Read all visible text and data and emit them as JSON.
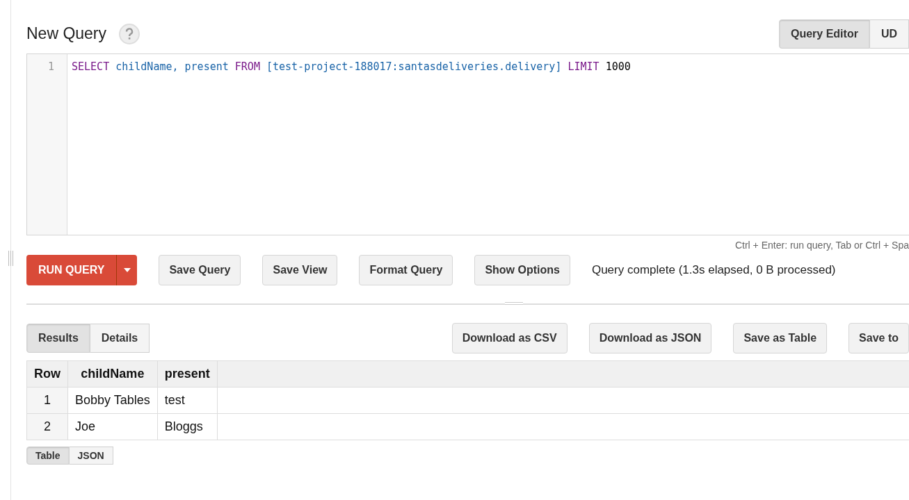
{
  "title": "New Query",
  "view_tabs": [
    {
      "label": "Query Editor",
      "selected": true
    },
    {
      "label": "UD",
      "selected": false
    }
  ],
  "editor": {
    "lines": [
      {
        "number": "1",
        "tokens": [
          {
            "kind": "keyword",
            "text": "SELECT"
          },
          {
            "kind": "ident",
            "text": "childName,"
          },
          {
            "kind": "ident",
            "text": "present"
          },
          {
            "kind": "keyword",
            "text": "FROM"
          },
          {
            "kind": "ident",
            "text": "[test-project-188017:santasdeliveries.delivery]"
          },
          {
            "kind": "keyword",
            "text": "LIMIT"
          },
          {
            "kind": "number",
            "text": "1000"
          }
        ]
      }
    ]
  },
  "hint": "Ctrl + Enter: run query, Tab or Ctrl + Spa",
  "run_button": "RUN QUERY",
  "actions": [
    "Save Query",
    "Save View",
    "Format Query",
    "Show Options"
  ],
  "status": "Query complete (1.3s elapsed, 0 B processed)",
  "result_tabs": [
    {
      "label": "Results",
      "selected": true
    },
    {
      "label": "Details",
      "selected": false
    }
  ],
  "downloads": [
    "Download as CSV",
    "Download as JSON",
    "Save as Table",
    "Save to"
  ],
  "table": {
    "columns": [
      "Row",
      "childName",
      "present"
    ],
    "rows": [
      [
        "1",
        "Bobby Tables",
        "test"
      ],
      [
        "2",
        "Joe",
        "Bloggs"
      ]
    ]
  },
  "format_tabs": [
    {
      "label": "Table",
      "selected": true
    },
    {
      "label": "JSON",
      "selected": false
    }
  ]
}
